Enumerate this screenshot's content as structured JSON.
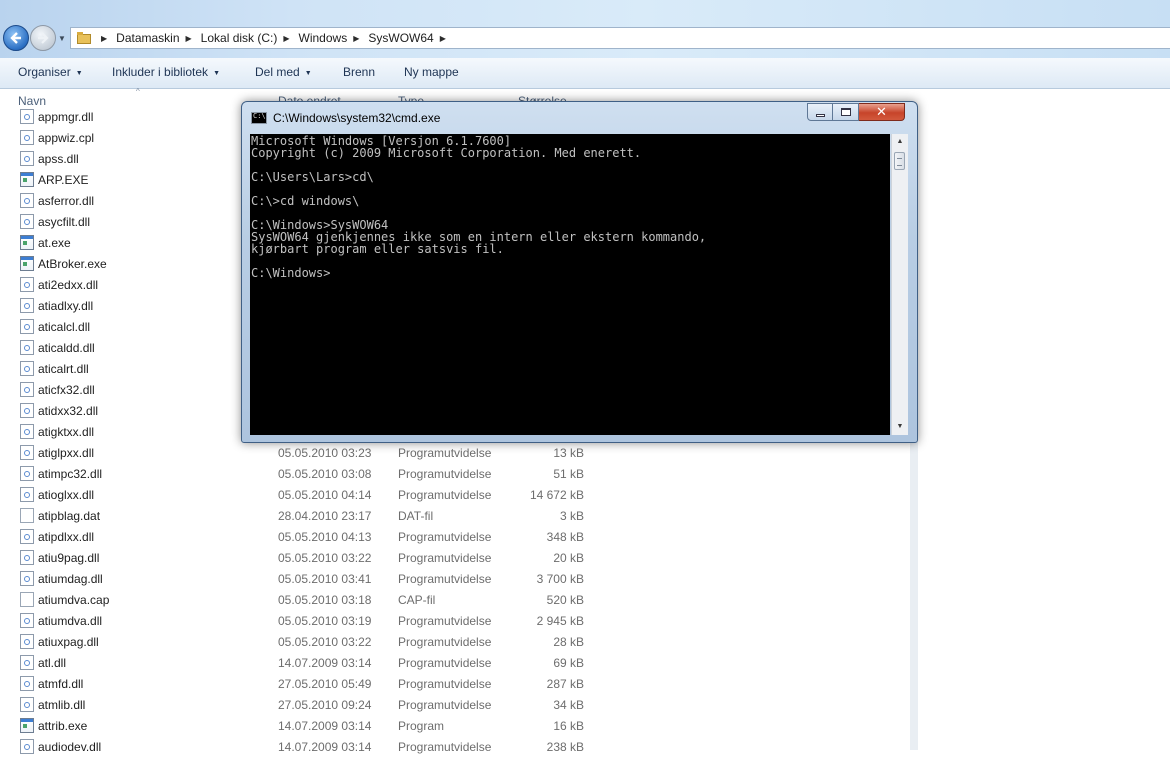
{
  "explorer": {
    "address": {
      "crumbs": [
        "Datamaskin",
        "Lokal disk (C:)",
        "Windows",
        "SysWOW64"
      ]
    },
    "toolbar": {
      "organize": "Organiser",
      "include_library": "Inkluder i bibliotek",
      "share_with": "Del med",
      "burn": "Brenn",
      "new_folder": "Ny mappe"
    },
    "columns": {
      "name": "Navn",
      "date_modified": "Dato endret",
      "type": "Type",
      "size": "Størrelse"
    },
    "files": [
      {
        "name": "appmgr.dll",
        "date": "",
        "type": "",
        "size": "",
        "icon": "dll-file-icon"
      },
      {
        "name": "appwiz.cpl",
        "date": "",
        "type": "",
        "size": "",
        "icon": "dll-file-icon"
      },
      {
        "name": "apss.dll",
        "date": "",
        "type": "",
        "size": "",
        "icon": "dll-file-icon"
      },
      {
        "name": "ARP.EXE",
        "date": "",
        "type": "",
        "size": "",
        "icon": "exe-file-icon"
      },
      {
        "name": "asferror.dll",
        "date": "",
        "type": "",
        "size": "",
        "icon": "dll-file-icon"
      },
      {
        "name": "asycfilt.dll",
        "date": "",
        "type": "",
        "size": "",
        "icon": "dll-file-icon"
      },
      {
        "name": "at.exe",
        "date": "",
        "type": "",
        "size": "",
        "icon": "exe-file-icon"
      },
      {
        "name": "AtBroker.exe",
        "date": "",
        "type": "",
        "size": "",
        "icon": "exe-file-icon"
      },
      {
        "name": "ati2edxx.dll",
        "date": "",
        "type": "",
        "size": "",
        "icon": "dll-file-icon"
      },
      {
        "name": "atiadlxy.dll",
        "date": "",
        "type": "",
        "size": "",
        "icon": "dll-file-icon"
      },
      {
        "name": "aticalcl.dll",
        "date": "",
        "type": "",
        "size": "",
        "icon": "dll-file-icon"
      },
      {
        "name": "aticaldd.dll",
        "date": "",
        "type": "",
        "size": "",
        "icon": "dll-file-icon"
      },
      {
        "name": "aticalrt.dll",
        "date": "",
        "type": "",
        "size": "",
        "icon": "dll-file-icon"
      },
      {
        "name": "aticfx32.dll",
        "date": "",
        "type": "",
        "size": "",
        "icon": "dll-file-icon"
      },
      {
        "name": "atidxx32.dll",
        "date": "",
        "type": "",
        "size": "",
        "icon": "dll-file-icon"
      },
      {
        "name": "atigktxx.dll",
        "date": "",
        "type": "",
        "size": "",
        "icon": "dll-file-icon"
      },
      {
        "name": "atiglpxx.dll",
        "date": "05.05.2010 03:23",
        "type": "Programutvidelse",
        "size": "13 kB",
        "icon": "dll-file-icon"
      },
      {
        "name": "atimpc32.dll",
        "date": "05.05.2010 03:08",
        "type": "Programutvidelse",
        "size": "51 kB",
        "icon": "dll-file-icon"
      },
      {
        "name": "atioglxx.dll",
        "date": "05.05.2010 04:14",
        "type": "Programutvidelse",
        "size": "14 672 kB",
        "icon": "dll-file-icon"
      },
      {
        "name": "atipblag.dat",
        "date": "28.04.2010 23:17",
        "type": "DAT-fil",
        "size": "3 kB",
        "icon": "dat-file-icon"
      },
      {
        "name": "atipdlxx.dll",
        "date": "05.05.2010 04:13",
        "type": "Programutvidelse",
        "size": "348 kB",
        "icon": "dll-file-icon"
      },
      {
        "name": "atiu9pag.dll",
        "date": "05.05.2010 03:22",
        "type": "Programutvidelse",
        "size": "20 kB",
        "icon": "dll-file-icon"
      },
      {
        "name": "atiumdag.dll",
        "date": "05.05.2010 03:41",
        "type": "Programutvidelse",
        "size": "3 700 kB",
        "icon": "dll-file-icon"
      },
      {
        "name": "atiumdva.cap",
        "date": "05.05.2010 03:18",
        "type": "CAP-fil",
        "size": "520 kB",
        "icon": "dat-file-icon"
      },
      {
        "name": "atiumdva.dll",
        "date": "05.05.2010 03:19",
        "type": "Programutvidelse",
        "size": "2 945 kB",
        "icon": "dll-file-icon"
      },
      {
        "name": "atiuxpag.dll",
        "date": "05.05.2010 03:22",
        "type": "Programutvidelse",
        "size": "28 kB",
        "icon": "dll-file-icon"
      },
      {
        "name": "atl.dll",
        "date": "14.07.2009 03:14",
        "type": "Programutvidelse",
        "size": "69 kB",
        "icon": "dll-file-icon"
      },
      {
        "name": "atmfd.dll",
        "date": "27.05.2010 05:49",
        "type": "Programutvidelse",
        "size": "287 kB",
        "icon": "dll-file-icon"
      },
      {
        "name": "atmlib.dll",
        "date": "27.05.2010 09:24",
        "type": "Programutvidelse",
        "size": "34 kB",
        "icon": "dll-file-icon"
      },
      {
        "name": "attrib.exe",
        "date": "14.07.2009 03:14",
        "type": "Program",
        "size": "16 kB",
        "icon": "exe-file-icon"
      },
      {
        "name": "audiodev.dll",
        "date": "14.07.2009 03:14",
        "type": "Programutvidelse",
        "size": "238 kB",
        "icon": "dll-file-icon"
      }
    ]
  },
  "cmd": {
    "title": "C:\\Windows\\system32\\cmd.exe",
    "lines": [
      "Microsoft Windows [Versjon 6.1.7600]",
      "Copyright (c) 2009 Microsoft Corporation. Med enerett.",
      "",
      "C:\\Users\\Lars>cd\\",
      "",
      "C:\\>cd windows\\",
      "",
      "C:\\Windows>SysWOW64",
      "SysWOW64 gjenkjennes ikke som en intern eller ekstern kommando,",
      "kjørbart program eller satsvis fil.",
      "",
      "C:\\Windows>"
    ],
    "text_color": "#c0c0c0",
    "background_color": "#000000"
  }
}
